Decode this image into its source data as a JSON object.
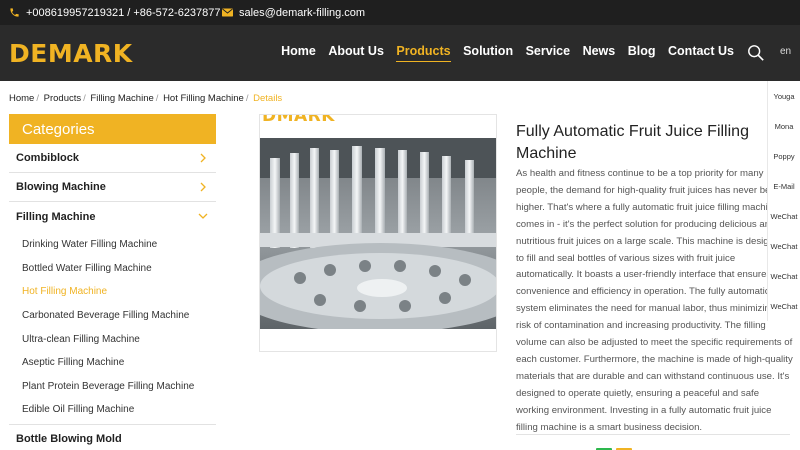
{
  "topbar": {
    "phone": "+008619957219321 / +86-572-6237877",
    "email": "sales@demark-filling.com"
  },
  "header": {
    "logo": "DEMARK",
    "nav": [
      "Home",
      "About Us",
      "Products",
      "Solution",
      "Service",
      "News",
      "Blog",
      "Contact Us"
    ],
    "active_nav": "Products",
    "lang": "en"
  },
  "breadcrumb": [
    "Home",
    "Products",
    "Filling Machine",
    "Hot Filling Machine",
    "Details"
  ],
  "sidebar": {
    "title": "Categories",
    "categories": [
      "Combiblock",
      "Blowing Machine",
      "Filling Machine",
      "Bottle Blowing Mold"
    ],
    "sub_items": [
      "Drinking Water Filling Machine",
      "Bottled Water Filling Machine",
      "Hot Filling Machine",
      "Carbonated Beverage Filling Machine",
      "Ultra-clean Filling Machine",
      "Aseptic Filling Machine",
      "Plant Protein Beverage Filling Machine",
      "Edible Oil Filling Machine"
    ],
    "active_sub": "Hot Filling Machine"
  },
  "product": {
    "image_brand": "DMARK",
    "title": "Fully Automatic Fruit Juice Filling Machine",
    "description": "As health and fitness continue to be a top priority for many people, the demand for high-quality fruit juices has never been higher. That's where a fully automatic fruit juice filling machine comes in - it's the perfect solution for producing delicious and nutritious fruit juices on a large scale. This machine is designed to fill and seal bottles of various sizes with fruit juice automatically. It boasts a user-friendly interface that ensures convenience and efficiency in operation. The fully automatic system eliminates the need for manual labor, thus minimizing the risk of contamination and increasing productivity. The filling volume can also be adjusted to meet the specific requirements of each customer. Furthermore, the machine is made of high-quality materials that are durable and can withstand continuous use. It's designed to operate quietly, ensuring a peaceful and safe working environment. Investing in a fully automatic fruit juice filling machine is a smart business decision."
  },
  "rail": [
    "Youga",
    "Mona",
    "Poppy",
    "E-Mail",
    "WeChat",
    "WeChat",
    "WeChat",
    "WeChat"
  ],
  "colors": {
    "accent": "#f0b323",
    "topbar": "#1f1f1f",
    "header": "#2b2b2b"
  }
}
